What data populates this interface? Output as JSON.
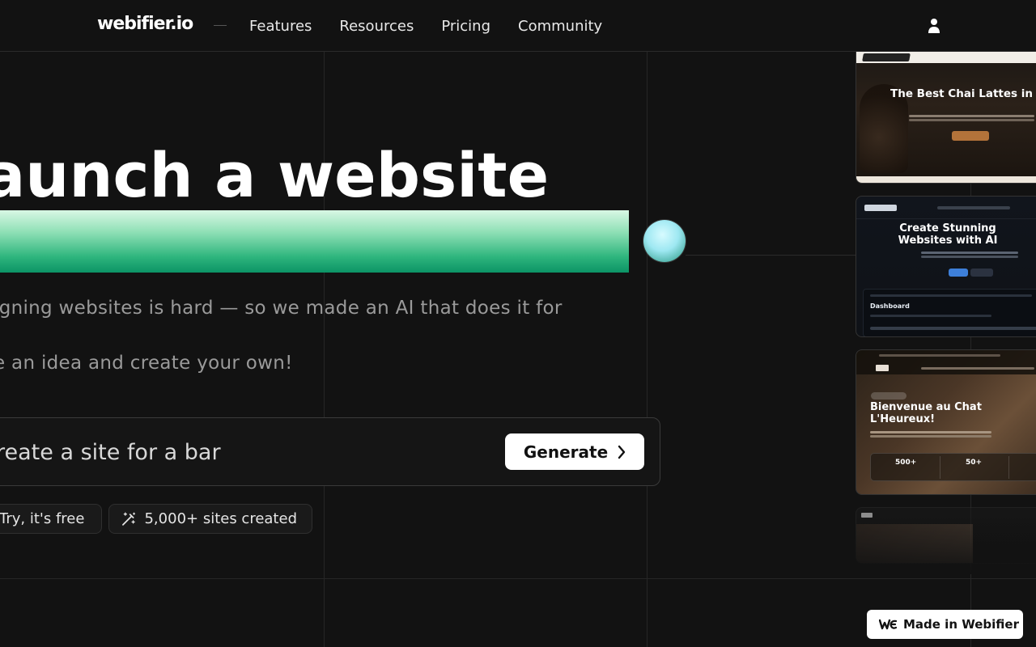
{
  "header": {
    "logo": "webifier.io",
    "nav": [
      "Features",
      "Resources",
      "Pricing",
      "Community"
    ]
  },
  "hero": {
    "title": "aunch a website",
    "subtitle_lines": [
      "igning websites is hard — so we made an AI that does it for",
      ".",
      "e an idea and create your own!"
    ]
  },
  "prompt": {
    "placeholder": "reate a site for a bar",
    "generate_label": "Generate"
  },
  "pills": {
    "try_label": "Try, it's free",
    "sites_label": "5,000+ sites created"
  },
  "previews": {
    "card1_title": "The Best Chai Lattes in Atlan",
    "card2_title_line1": "Create Stunning",
    "card2_title_line2": "Websites with AI",
    "card2_dashboard": "Dashboard",
    "card3_title_line1": "Bienvenue au Chat",
    "card3_title_line2": "L'Heureux!",
    "card3_stat1": "500+",
    "card3_stat2": "50+"
  },
  "badge": {
    "label": "Made in Webifier"
  },
  "colors": {
    "background": "#121212",
    "accent_green": "#0c9466",
    "orb": "#9ee8f2"
  }
}
